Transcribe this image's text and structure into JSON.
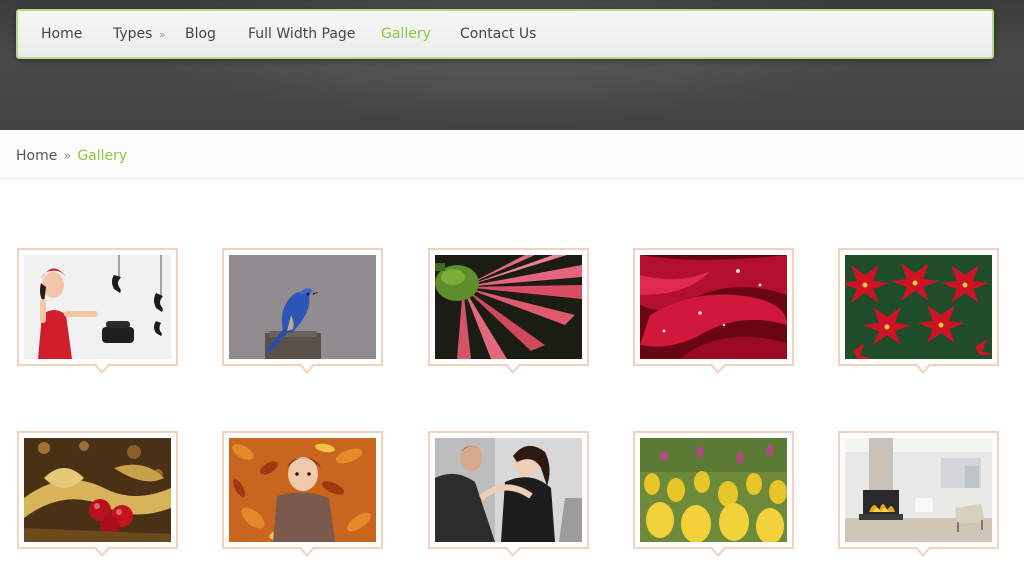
{
  "nav": {
    "items": [
      {
        "label": "Home"
      },
      {
        "label": "Types"
      },
      {
        "label": "Blog"
      },
      {
        "label": "Full Width Page"
      },
      {
        "label": "Gallery"
      },
      {
        "label": "Contact Us"
      }
    ],
    "types_arrow": "»",
    "active_item": "Gallery",
    "accent_color": "#8dc63f",
    "border_color": "#b8d88e"
  },
  "breadcrumb": {
    "home": "Home",
    "separator": "»",
    "current": "Gallery"
  },
  "gallery": {
    "thumbnail_frame_color": "#f2d2bf",
    "items": [
      {
        "subject": "woman with vintage telephones"
      },
      {
        "subject": "bluebird on post"
      },
      {
        "subject": "pink gerbera flower"
      },
      {
        "subject": "red rose petals with drops"
      },
      {
        "subject": "red poinsettias"
      },
      {
        "subject": "christmas ornaments with gold ribbon"
      },
      {
        "subject": "child lying in autumn leaves"
      },
      {
        "subject": "couple portrait"
      },
      {
        "subject": "yellow tulip field"
      },
      {
        "subject": "modern living room with fireplace"
      }
    ]
  }
}
